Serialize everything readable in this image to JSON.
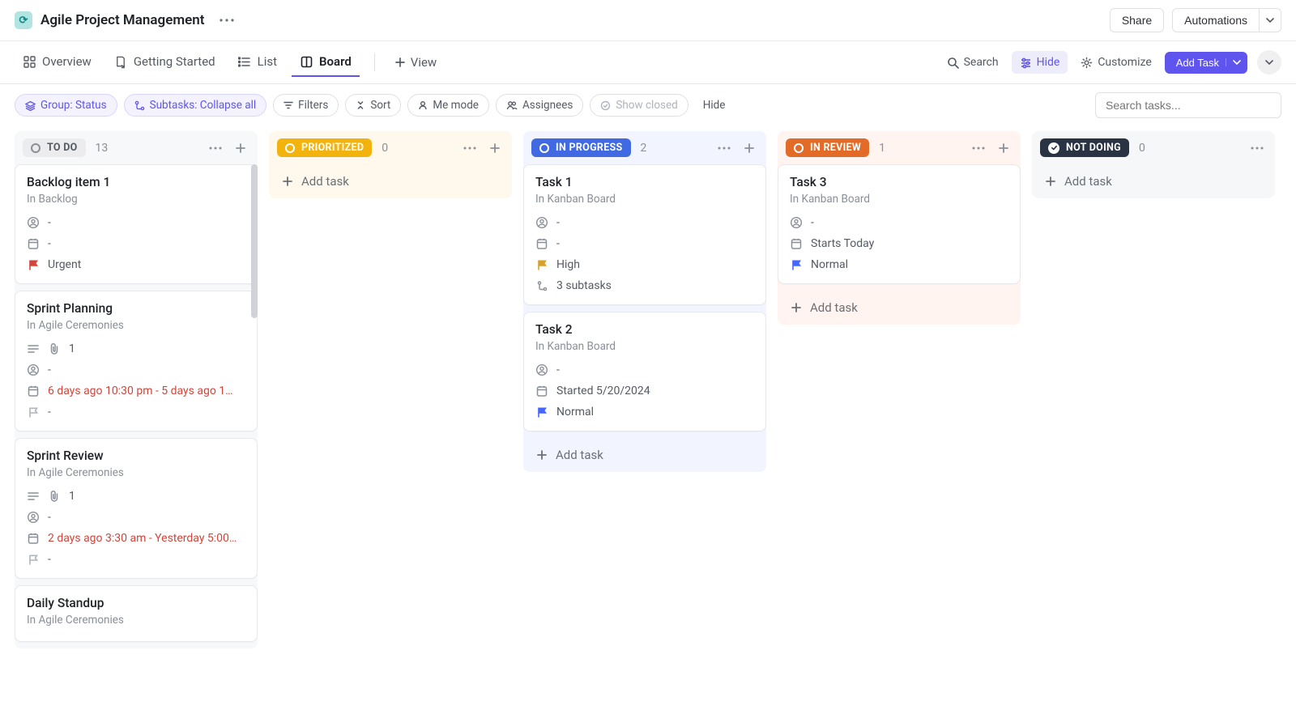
{
  "header": {
    "app_icon_letter": "⟳",
    "title": "Agile Project Management",
    "share": "Share",
    "automations": "Automations"
  },
  "views": {
    "overview": "Overview",
    "getting_started": "Getting Started",
    "list": "List",
    "board": "Board",
    "add_view": "View",
    "search": "Search",
    "hide": "Hide",
    "customize": "Customize",
    "add_task": "Add Task"
  },
  "filters": {
    "group": "Group: Status",
    "subtasks": "Subtasks: Collapse all",
    "filters": "Filters",
    "sort": "Sort",
    "me_mode": "Me mode",
    "assignees": "Assignees",
    "show_closed": "Show closed",
    "hide": "Hide",
    "search_placeholder": "Search tasks..."
  },
  "columns": [
    {
      "id": "todo",
      "label": "TO DO",
      "count": "13",
      "pill_class": "pill-todo",
      "circle_color": "#8a8f98",
      "cards": [
        {
          "title": "Backlog item 1",
          "location": "In Backlog",
          "rows": [
            {
              "type": "assignee",
              "text": "-"
            },
            {
              "type": "date",
              "text": "-"
            },
            {
              "type": "flag",
              "text": "Urgent",
              "flag": "urgent"
            }
          ]
        },
        {
          "title": "Sprint Planning",
          "location": "In Agile Ceremonies",
          "rows": [
            {
              "type": "desc_attach",
              "text": "1"
            },
            {
              "type": "assignee",
              "text": "-"
            },
            {
              "type": "date",
              "text": "6 days ago 10:30 pm - 5 days ago 1…",
              "red": true
            },
            {
              "type": "flag",
              "text": "-",
              "flag": "none"
            }
          ]
        },
        {
          "title": "Sprint Review",
          "location": "In Agile Ceremonies",
          "rows": [
            {
              "type": "desc_attach",
              "text": "1"
            },
            {
              "type": "assignee",
              "text": "-"
            },
            {
              "type": "date",
              "text": "2 days ago 3:30 am - Yesterday 5:00…",
              "red": true
            },
            {
              "type": "flag",
              "text": "-",
              "flag": "none"
            }
          ]
        },
        {
          "title": "Daily Standup",
          "location": "In Agile Ceremonies",
          "rows": []
        }
      ]
    },
    {
      "id": "prioritized",
      "label": "PRIORITIZED",
      "count": "0",
      "pill_class": "pill-prioritized",
      "circle_color": "#ffffff",
      "add_task_label": "Add task",
      "cards": []
    },
    {
      "id": "inprogress",
      "label": "IN PROGRESS",
      "count": "2",
      "pill_class": "pill-inprogress",
      "circle_color": "#ffffff",
      "add_task_label": "Add task",
      "cards": [
        {
          "title": "Task 1",
          "location": "In Kanban Board",
          "rows": [
            {
              "type": "assignee",
              "text": "-"
            },
            {
              "type": "date",
              "text": "-"
            },
            {
              "type": "flag",
              "text": "High",
              "flag": "high"
            },
            {
              "type": "subtasks",
              "text": "3 subtasks"
            }
          ]
        },
        {
          "title": "Task 2",
          "location": "In Kanban Board",
          "rows": [
            {
              "type": "assignee",
              "text": "-"
            },
            {
              "type": "date",
              "text": "Started 5/20/2024"
            },
            {
              "type": "flag",
              "text": "Normal",
              "flag": "normal"
            }
          ]
        }
      ]
    },
    {
      "id": "inreview",
      "label": "IN REVIEW",
      "count": "1",
      "pill_class": "pill-inreview",
      "circle_color": "#ffffff",
      "add_task_label": "Add task",
      "cards": [
        {
          "title": "Task 3",
          "location": "In Kanban Board",
          "rows": [
            {
              "type": "assignee",
              "text": "-"
            },
            {
              "type": "date",
              "text": "Starts Today"
            },
            {
              "type": "flag",
              "text": "Normal",
              "flag": "normal"
            }
          ]
        }
      ]
    },
    {
      "id": "notdoing",
      "label": "NOT DOING",
      "count": "0",
      "pill_class": "pill-notdoing",
      "closed": true,
      "add_task_label": "Add task",
      "cards": []
    }
  ]
}
